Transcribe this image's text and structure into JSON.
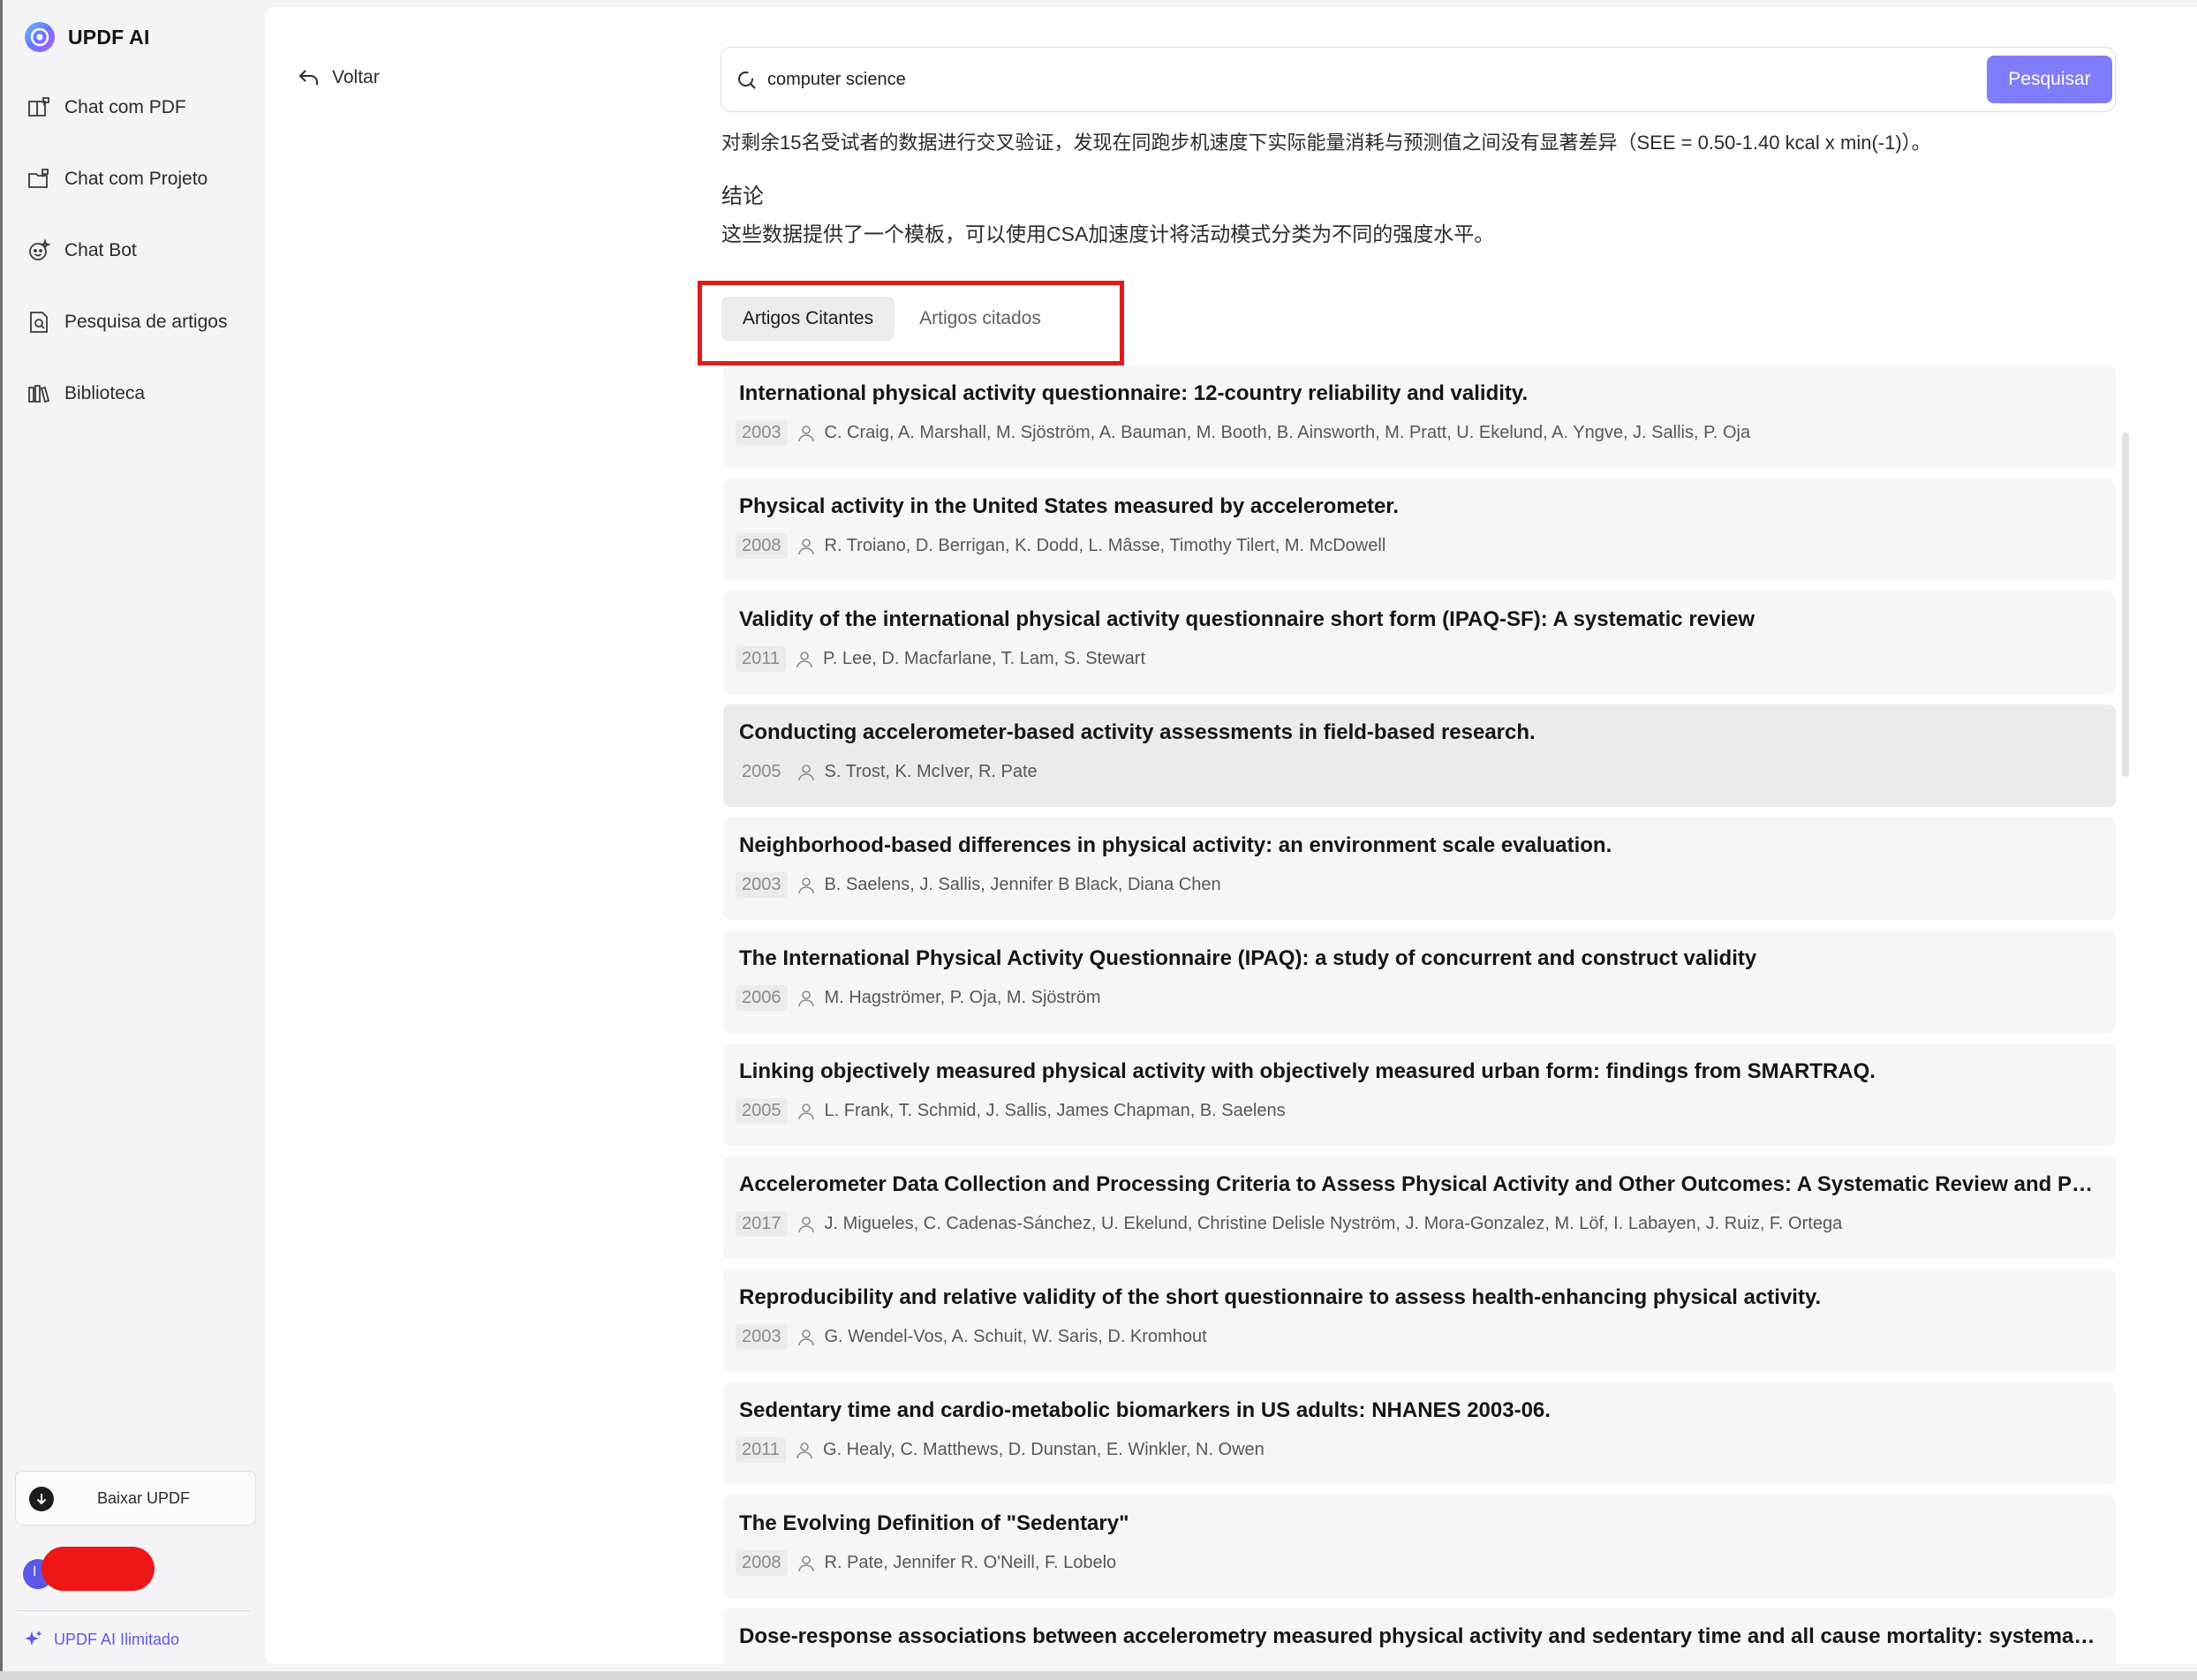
{
  "app": {
    "name": "UPDF AI"
  },
  "sidebar": {
    "items": [
      {
        "label": "Chat com PDF",
        "icon": "book-chat-icon"
      },
      {
        "label": "Chat com Projeto",
        "icon": "folder-chat-icon"
      },
      {
        "label": "Chat Bot",
        "icon": "bot-icon"
      },
      {
        "label": "Pesquisa de artigos",
        "icon": "document-search-icon"
      },
      {
        "label": "Biblioteca",
        "icon": "library-icon"
      }
    ],
    "download_label": "Baixar UPDF",
    "user_initial": "I",
    "unlimited_label": "UPDF AI Ilimitado"
  },
  "back": {
    "label": "Voltar"
  },
  "search": {
    "value": "computer science",
    "button_label": "Pesquisar"
  },
  "article": {
    "abstract_cut": "对剩余15名受试者的数据进行交叉验证，发现在同跑步机速度下实际能量消耗与预测值之间没有显著差异（SEE = 0.50-1.40 kcal x min(-1)）。",
    "conclusion_heading": "结论",
    "conclusion_text": "这些数据提供了一个模板，可以使用CSA加速度计将活动模式分类为不同的强度水平。"
  },
  "tabs": [
    {
      "label": "Artigos Citantes",
      "active": true
    },
    {
      "label": "Artigos citados",
      "active": false
    }
  ],
  "results": [
    {
      "title": "International physical activity questionnaire: 12-country reliability and validity.",
      "year": "2003",
      "authors": "C. Craig, A. Marshall, M. Sjöström, A. Bauman, M. Booth, B. Ainsworth, M. Pratt, U. Ekelund, A. Yngve, J. Sallis, P. Oja"
    },
    {
      "title": "Physical activity in the United States measured by accelerometer.",
      "year": "2008",
      "authors": "R. Troiano, D. Berrigan, K. Dodd, L. Mâsse, Timothy Tilert, M. McDowell"
    },
    {
      "title": "Validity of the international physical activity questionnaire short form (IPAQ-SF): A systematic review",
      "year": "2011",
      "authors": "P. Lee, D. Macfarlane, T. Lam, S. Stewart"
    },
    {
      "title": "Conducting accelerometer-based activity assessments in field-based research.",
      "year": "2005",
      "authors": "S. Trost, K. McIver, R. Pate"
    },
    {
      "title": "Neighborhood-based differences in physical activity: an environment scale evaluation.",
      "year": "2003",
      "authors": "B. Saelens, J. Sallis, Jennifer B Black, Diana Chen"
    },
    {
      "title": "The International Physical Activity Questionnaire (IPAQ): a study of concurrent and construct validity",
      "year": "2006",
      "authors": "M. Hagströmer, P. Oja, M. Sjöström"
    },
    {
      "title": "Linking objectively measured physical activity with objectively measured urban form: findings from SMARTRAQ.",
      "year": "2005",
      "authors": "L. Frank, T. Schmid, J. Sallis, James Chapman, B. Saelens"
    },
    {
      "title": "Accelerometer Data Collection and Processing Criteria to Assess Physical Activity and Other Outcomes: A Systematic Review and Prac...",
      "year": "2017",
      "authors": "J. Migueles, C. Cadenas-Sánchez, U. Ekelund, Christine Delisle Nyström, J. Mora-Gonzalez, M. Löf, I. Labayen, J. Ruiz, F. Ortega"
    },
    {
      "title": "Reproducibility and relative validity of the short questionnaire to assess health-enhancing physical activity.",
      "year": "2003",
      "authors": "G. Wendel-Vos, A. Schuit, W. Saris, D. Kromhout"
    },
    {
      "title": "Sedentary time and cardio-metabolic biomarkers in US adults: NHANES 2003-06.",
      "year": "2011",
      "authors": "G. Healy, C. Matthews, D. Dunstan, E. Winkler, N. Owen"
    },
    {
      "title": "The Evolving Definition of \"Sedentary\"",
      "year": "2008",
      "authors": "R. Pate, Jennifer R. O'Neill, F. Lobelo"
    },
    {
      "title": "Dose-response associations between accelerometry measured physical activity and sedentary time and all cause mortality: systemati...",
      "year": "",
      "authors": ""
    }
  ],
  "colors": {
    "accent": "#7f7dfa",
    "annotation_box": "#e21b1b",
    "redaction": "#ee1717"
  }
}
